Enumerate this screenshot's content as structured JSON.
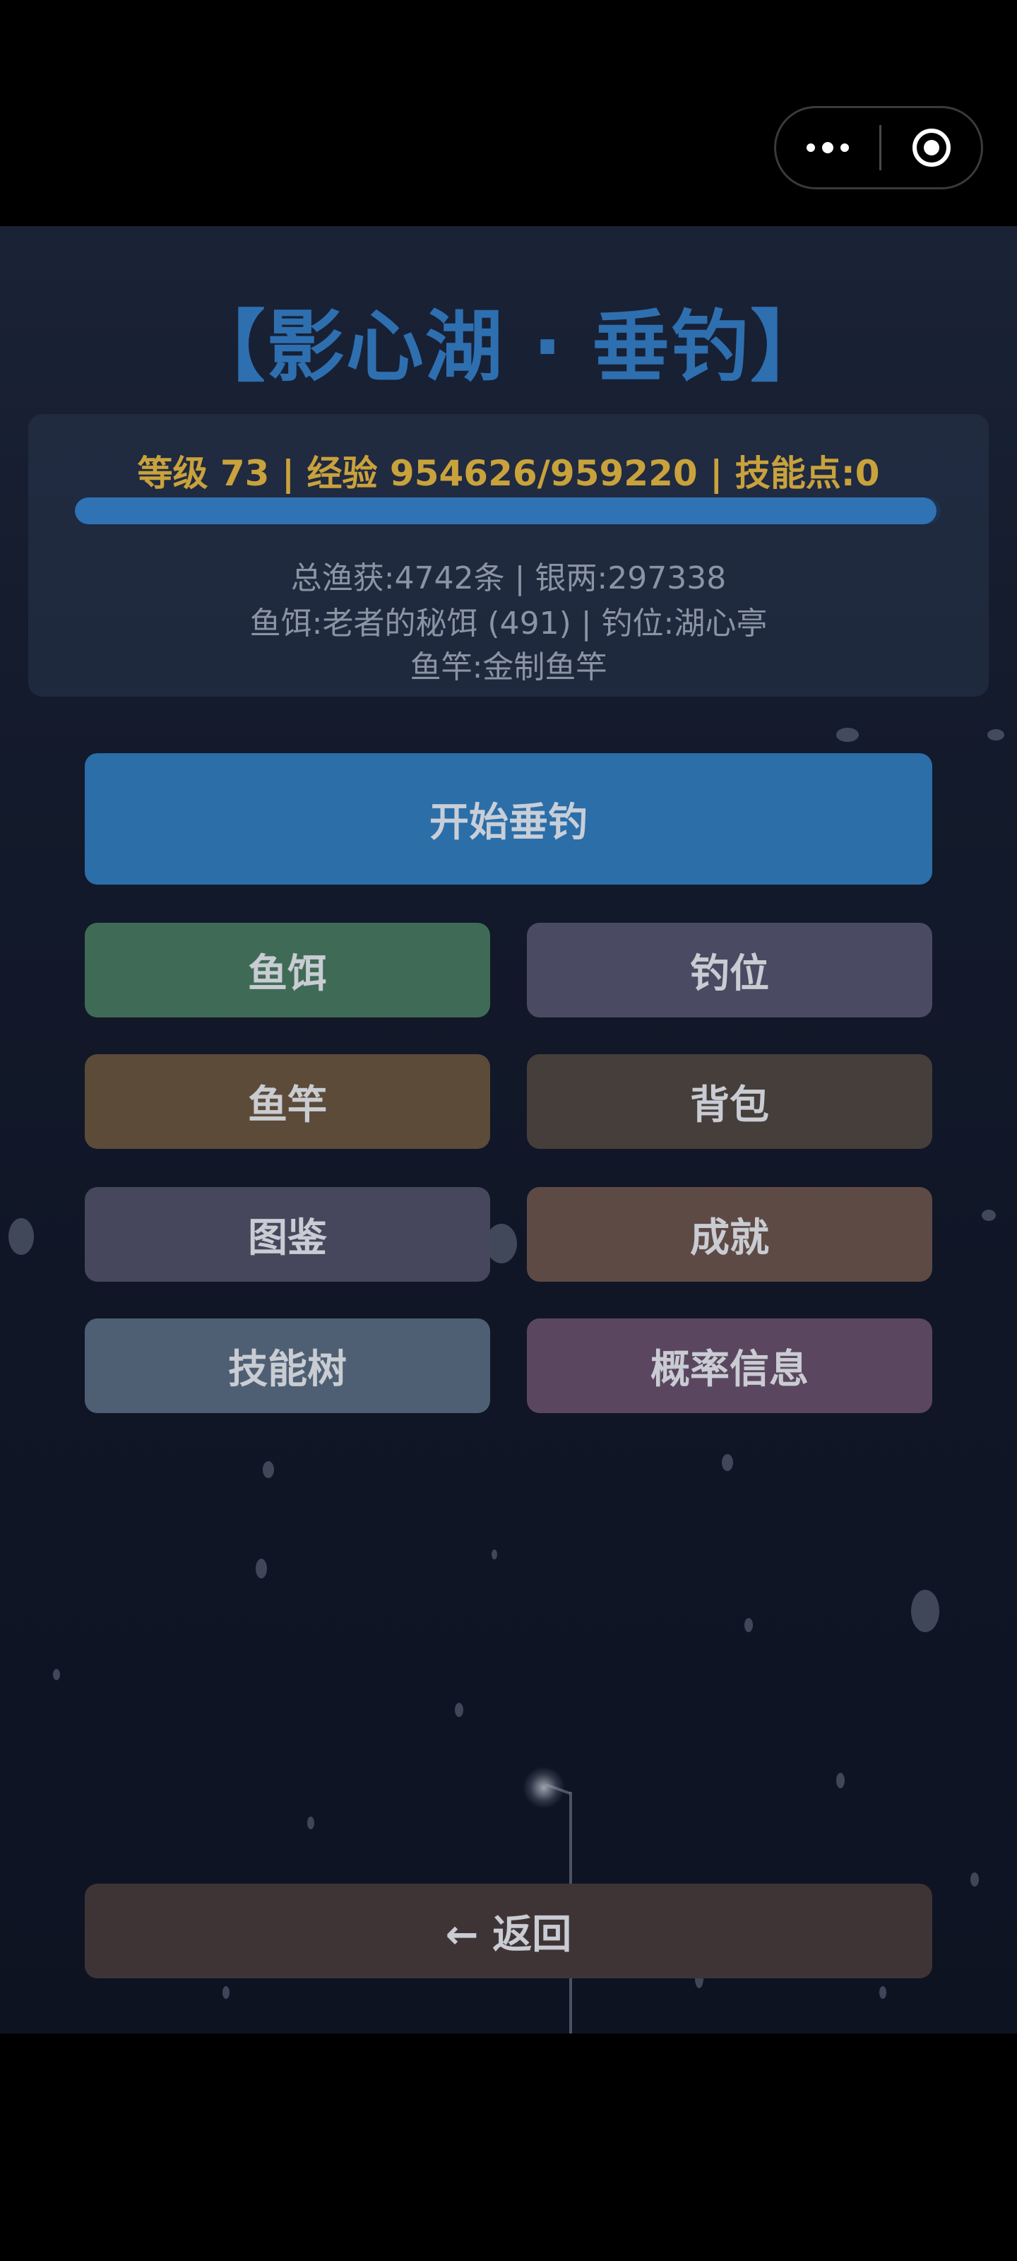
{
  "capsule": {
    "more_icon": "more-dots-icon",
    "close_icon": "target-circle-icon"
  },
  "header": {
    "title": "【影心湖 · 垂钓】"
  },
  "stats": {
    "level_line": "等级 73 | 经验 954626/959220 | 技能点:0",
    "exp_progress": 0.9952,
    "catch_line": "总渔获:4742条 | 银两:297338",
    "bait_spot_line": "鱼饵:老者的秘饵 (491) | 钓位:湖心亭",
    "rod_line": "鱼竿:金制鱼竿"
  },
  "buttons": {
    "start": "开始垂钓",
    "bait": "鱼饵",
    "spot": "钓位",
    "rod": "鱼竿",
    "bag": "背包",
    "guide": "图鉴",
    "achievement": "成就",
    "skill_tree": "技能树",
    "probability": "概率信息",
    "back": "← 返回"
  },
  "colors": {
    "title": "#2e6fb0",
    "level_text": "#c9a23c",
    "exp_fill": "#2f73b5",
    "start_button": "#2b6ea8"
  }
}
